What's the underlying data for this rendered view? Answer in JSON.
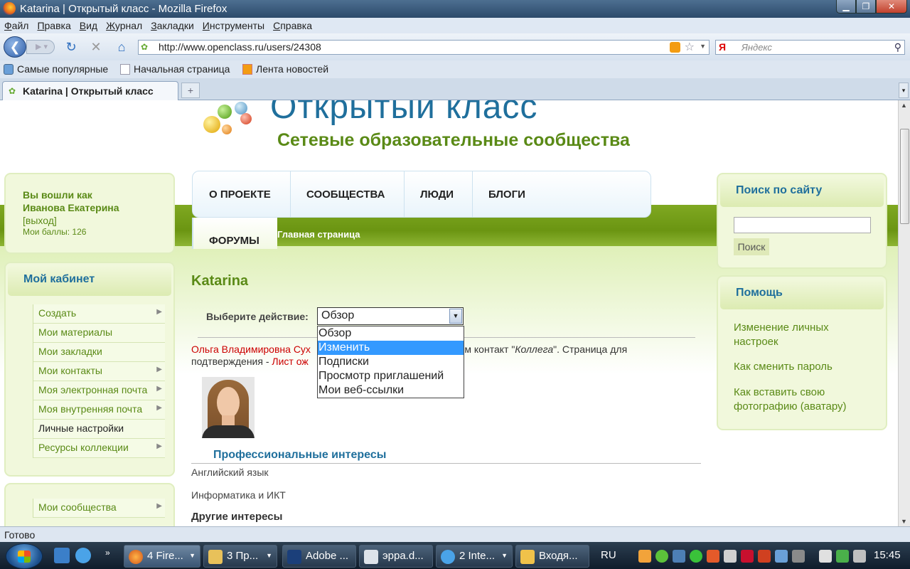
{
  "window": {
    "title": "Katarina | Открытый класс - Mozilla Firefox"
  },
  "menubar": [
    "Файл",
    "Правка",
    "Вид",
    "Журнал",
    "Закладки",
    "Инструменты",
    "Справка"
  ],
  "navbar": {
    "url": "http://www.openclass.ru/users/24308",
    "search_placeholder": "Яндекс",
    "search_engine_glyph": "Я"
  },
  "bookmarks": [
    "Самые популярные",
    "Начальная страница",
    "Лента новостей"
  ],
  "tab": {
    "title": "Katarina | Открытый класс"
  },
  "site": {
    "logo_title": "Открытый класс",
    "logo_subtitle": "Сетевые образовательные сообщества"
  },
  "login": {
    "line1": "Вы вошли как",
    "user": "Иванова Екатерина",
    "logout": "[выход]",
    "points": "Мои баллы: 126"
  },
  "cabinet": {
    "title": "Мой кабинет",
    "items": [
      {
        "label": "Создать",
        "arrow": "▶"
      },
      {
        "label": "Мои материалы",
        "arrow": ""
      },
      {
        "label": "Мои закладки",
        "arrow": ""
      },
      {
        "label": "Мои контакты",
        "arrow": "▶"
      },
      {
        "label": "Моя электронная почта",
        "arrow": "▶"
      },
      {
        "label": "Моя внутренняя почта",
        "arrow": "▶"
      },
      {
        "label": "Личные настройки",
        "arrow": ""
      },
      {
        "label": "Ресурсы коллекции",
        "arrow": "▶"
      }
    ]
  },
  "communities": {
    "label": "Мои сообщества",
    "arrow": "▶"
  },
  "topnav": [
    "О ПРОЕКТЕ",
    "СООБЩЕСТВА",
    "ЛЮДИ",
    "БЛОГИ"
  ],
  "forums": "ФОРУМЫ",
  "breadcrumb": "Главная страница",
  "page": {
    "title": "Katarina",
    "action_label": "Выберите действие:",
    "action_value": "Обзор",
    "dropdown_options": [
      "Обзор",
      "Изменить",
      "Подписки",
      "Просмотр приглашений",
      "Мои веб-ссылки"
    ],
    "dropdown_selected_index": 1,
    "notice_name": "Ольга Владимировна Сух",
    "notice_text1": "с ним контакт \"",
    "notice_em": "Коллега",
    "notice_text2": "\". Страница для",
    "notice_line2_prefix": "подтверждения - ",
    "notice_line2_link": "Лист ож",
    "interests_title": "Профессиональные интересы",
    "interests": [
      "Английский язык",
      "Информатика и ИКТ"
    ],
    "other_interests": "Другие интересы"
  },
  "search_panel": {
    "title": "Поиск по сайту",
    "button": "Поиск",
    "value": ""
  },
  "help_panel": {
    "title": "Помощь",
    "links": [
      "Изменение личных настроек",
      "Как сменить пароль",
      "Как вставить свою фотографию (аватару)"
    ]
  },
  "status": "Готово",
  "taskbar": {
    "buttons": [
      "4 Fire...",
      "3 Пр...",
      "Adobe ...",
      "эрра.d...",
      "2 Inte...",
      "Входя..."
    ],
    "language": "RU",
    "clock": "15:45"
  },
  "colors": {
    "accent_green": "#5a8a16",
    "link_blue": "#1f6f9c",
    "selection": "#3399ff"
  }
}
